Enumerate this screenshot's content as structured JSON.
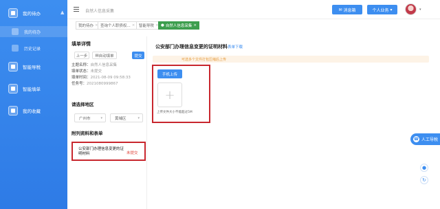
{
  "sidebar": {
    "items": [
      {
        "label": "我的待办",
        "icon": "todo-icon"
      },
      {
        "label": "我的待办",
        "icon": "todo-sub-icon"
      },
      {
        "label": "历史记录",
        "icon": "history-icon"
      },
      {
        "label": "智能导税",
        "icon": "tax-guide-icon"
      },
      {
        "label": "智能填单",
        "icon": "form-fill-icon"
      },
      {
        "label": "我的收藏",
        "icon": "favorite-icon"
      }
    ],
    "accent": "#3d8ef0"
  },
  "header": {
    "breadcrumb": "自然人信息采集",
    "msg_label": "消息箱",
    "biz_label": "个人业务"
  },
  "tabs": [
    {
      "label": "我的待办",
      "active": false
    },
    {
      "label": "查询个人职债权...",
      "active": false
    },
    {
      "label": "智能导税",
      "active": false
    },
    {
      "label": "自然人信息采集",
      "active": true
    }
  ],
  "left": {
    "title": "填单详情",
    "buttons": {
      "prev": "上一步",
      "auto": "自动填单",
      "submit": "提交"
    },
    "info": [
      {
        "k": "主题名称：",
        "v": "自然人信息采集"
      },
      {
        "k": "填单状态：",
        "v": "未提交"
      },
      {
        "k": "填单时间：",
        "v": "2021-08-09 09:58:33"
      },
      {
        "k": "任务号：",
        "v": "2021080999867"
      }
    ],
    "region_title": "请选择地区",
    "city": "广州市",
    "district": "黄埔区",
    "materials_title": "附列资料和表单",
    "material": {
      "name": "公安部门办理信息变更的证明材料",
      "status": "未提交"
    }
  },
  "main": {
    "title": "公安部门办理信息变更的证明材料",
    "link": "表单下载",
    "notice": "可选多个文件打包压缩后上传",
    "upload_btn": "手机上传",
    "plus": "+",
    "upload_hint": "上传文件大小不能超过5M"
  },
  "floating": {
    "assist": "人工导税"
  }
}
